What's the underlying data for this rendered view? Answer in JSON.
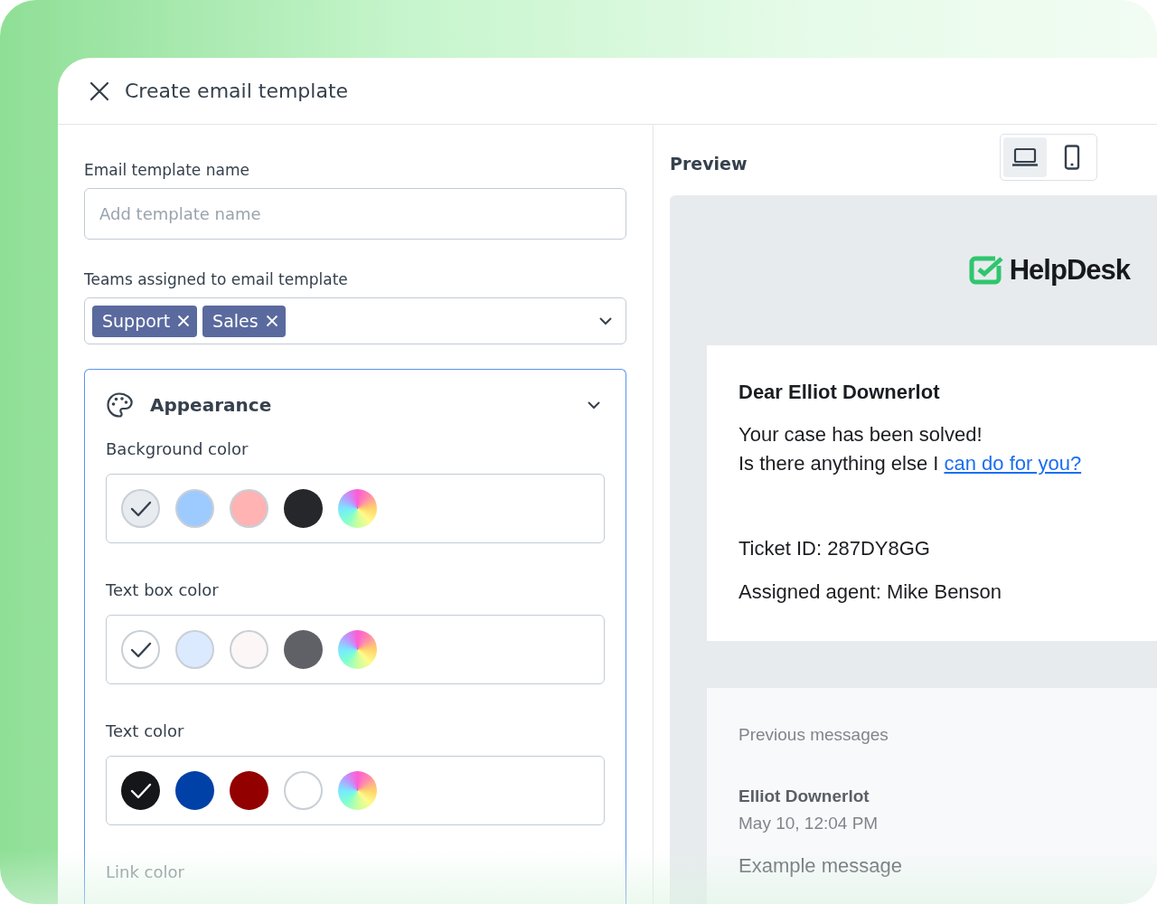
{
  "dialog": {
    "title": "Create email template"
  },
  "name_field": {
    "label": "Email template name",
    "placeholder": "Add template name"
  },
  "teams_field": {
    "label": "Teams assigned to email template",
    "tags": [
      "Support",
      "Sales"
    ]
  },
  "appearance": {
    "title": "Appearance",
    "expanded": true,
    "groups": [
      {
        "label": "Background color",
        "swatches": [
          {
            "kind": "solid",
            "color": "#e8ebef",
            "selected": true
          },
          {
            "kind": "solid",
            "color": "#9ecbff",
            "selected": false
          },
          {
            "kind": "solid",
            "color": "#ffb3b3",
            "selected": false
          },
          {
            "kind": "solid",
            "color": "#25272b",
            "selected": false
          },
          {
            "kind": "picker",
            "selected": false
          }
        ]
      },
      {
        "label": "Text box color",
        "swatches": [
          {
            "kind": "solid",
            "color": "#ffffff",
            "selected": true
          },
          {
            "kind": "solid",
            "color": "#dbeafe",
            "selected": false
          },
          {
            "kind": "solid",
            "color": "#fdf6f6",
            "selected": false
          },
          {
            "kind": "solid",
            "color": "#5f6167",
            "selected": false
          },
          {
            "kind": "picker",
            "selected": false
          }
        ]
      },
      {
        "label": "Text color",
        "swatches": [
          {
            "kind": "solid",
            "color": "#15161a",
            "selected": true
          },
          {
            "kind": "solid",
            "color": "#0041a8",
            "selected": false
          },
          {
            "kind": "solid",
            "color": "#930000",
            "selected": false
          },
          {
            "kind": "solid",
            "color": "#ffffff",
            "selected": false
          },
          {
            "kind": "picker",
            "selected": false
          }
        ]
      },
      {
        "label": "Link color"
      }
    ]
  },
  "preview": {
    "title": "Preview",
    "devices": [
      {
        "kind": "desktop",
        "selected": true
      },
      {
        "kind": "mobile",
        "selected": false
      }
    ],
    "logo_text": "HelpDesk",
    "greeting": "Dear Elliot Downerlot",
    "line_1": "Your case has been solved!",
    "line_2": "Is there anything else I ",
    "line_2_link": "can do for you?",
    "ticket": "Ticket ID: 287DY8GG",
    "agent": "Assigned agent: Mike Benson",
    "previous": {
      "heading": "Previous messages",
      "author": "Elliot Downerlot",
      "time": "May 10, 12:04 PM",
      "message": "Example message"
    }
  }
}
